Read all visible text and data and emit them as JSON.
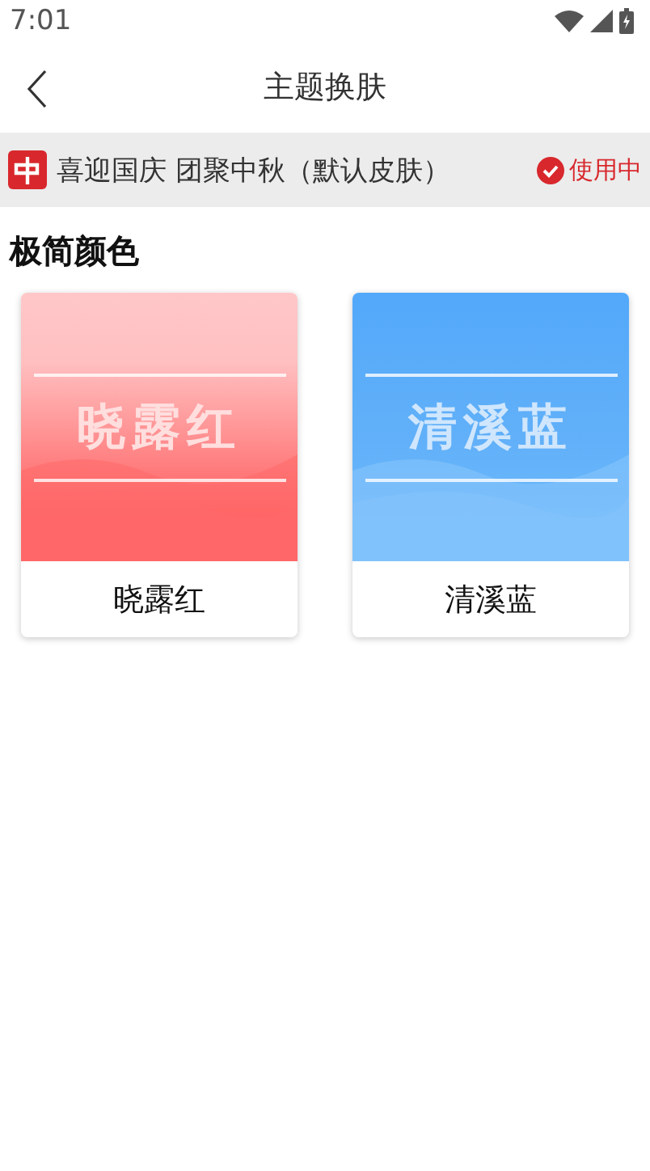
{
  "status_bar": {
    "time": "7:01"
  },
  "header": {
    "title": "主题换肤"
  },
  "current_skin": {
    "name": "喜迎国庆 团聚中秋（默认皮肤）",
    "status": "使用中"
  },
  "section": {
    "title": "极简颜色"
  },
  "themes": [
    {
      "kind": "red",
      "preview_title": "晓露红",
      "label": "晓露红"
    },
    {
      "kind": "blue",
      "preview_title": "清溪蓝",
      "label": "清溪蓝"
    }
  ]
}
